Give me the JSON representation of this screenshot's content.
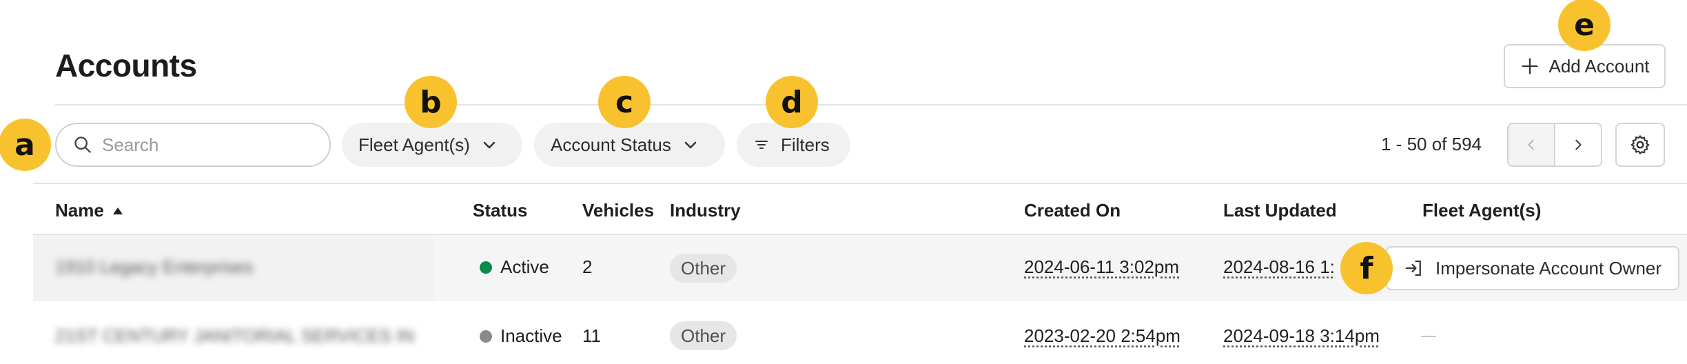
{
  "page": {
    "title": "Accounts"
  },
  "toolbar": {
    "add_account_label": "Add Account",
    "search_placeholder": "Search",
    "fleet_agent_filter": "Fleet Agent(s)",
    "account_status_filter": "Account Status",
    "filters_label": "Filters",
    "range_text": "1 - 50 of 594"
  },
  "table": {
    "columns": {
      "name": "Name",
      "status": "Status",
      "vehicles": "Vehicles",
      "industry": "Industry",
      "created_on": "Created On",
      "last_updated": "Last Updated",
      "fleet_agents": "Fleet Agent(s)"
    },
    "rows": [
      {
        "name": "1910 Legacy Enterprises",
        "status": "Active",
        "status_color": "#0f8a4a",
        "vehicles": "2",
        "industry": "Other",
        "created_on": "2024-06-11 3:02pm",
        "last_updated": "2024-08-16 1:",
        "action_label": "Impersonate Account Owner"
      },
      {
        "name": "21ST CENTURY JANITORIAL SERVICES IN",
        "status": "Inactive",
        "status_color": "#8a8a8a",
        "vehicles": "11",
        "industry": "Other",
        "created_on": "2023-02-20 2:54pm",
        "last_updated": "2024-09-18 3:14pm",
        "fleet_agents": "—"
      }
    ]
  },
  "markers": {
    "a": "a",
    "b": "b",
    "c": "c",
    "d": "d",
    "e": "e",
    "f": "f"
  },
  "colors": {
    "marker": "#f8c22e",
    "active": "#0f8a4a",
    "inactive": "#8a8a8a"
  },
  "icons": [
    "plus-icon",
    "search-icon",
    "chevron-down-icon",
    "filter-icon",
    "chevron-left-icon",
    "chevron-right-icon",
    "gear-icon",
    "sort-asc-icon",
    "login-icon"
  ]
}
